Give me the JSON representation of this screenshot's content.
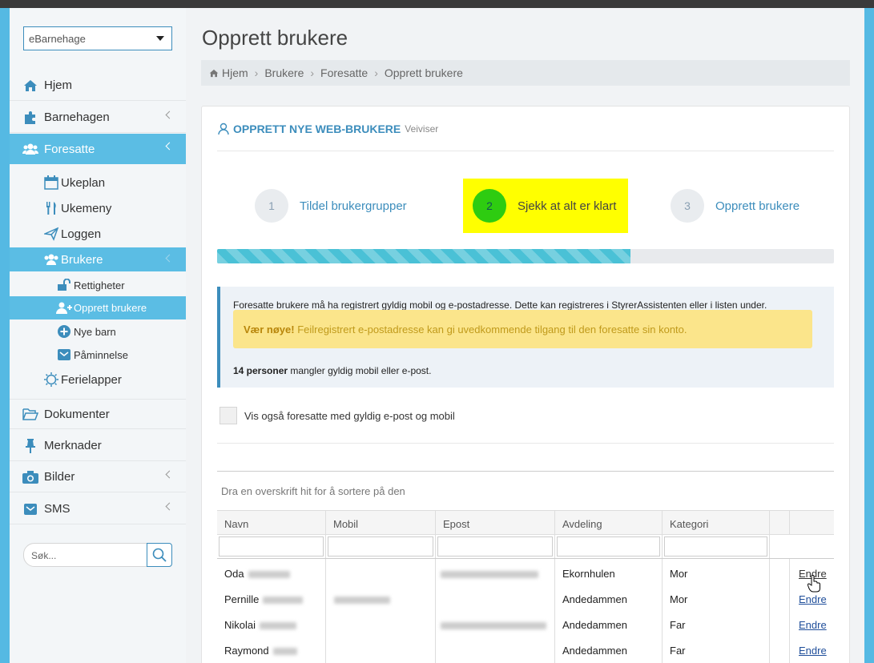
{
  "select": {
    "value": "eBarnehage"
  },
  "nav": [
    {
      "label": "Hjem"
    },
    {
      "label": "Barnehagen"
    },
    {
      "label": "Foresatte"
    },
    {
      "label": "Dokumenter"
    },
    {
      "label": "Merknader"
    },
    {
      "label": "Bilder"
    },
    {
      "label": "SMS"
    }
  ],
  "sub": [
    {
      "label": "Ukeplan"
    },
    {
      "label": "Ukemeny"
    },
    {
      "label": "Loggen"
    },
    {
      "label": "Brukere"
    },
    {
      "label": "Ferielapper"
    }
  ],
  "subsub": [
    {
      "label": "Rettigheter"
    },
    {
      "label": "Opprett brukere"
    },
    {
      "label": "Nye barn"
    },
    {
      "label": "Påminnelse"
    }
  ],
  "search": {
    "placeholder": "Søk..."
  },
  "page": {
    "title": "Opprett brukere"
  },
  "breadcrumb": [
    "Hjem",
    "Brukere",
    "Foresatte",
    "Opprett brukere"
  ],
  "panel": {
    "title": "OPPRETT NYE WEB-BRUKERE",
    "subtitle": "Veiviser"
  },
  "steps": [
    {
      "num": "1",
      "label": "Tildel brukergrupper"
    },
    {
      "num": "2",
      "label": "Sjekk at alt er klart"
    },
    {
      "num": "3",
      "label": "Opprett brukere"
    }
  ],
  "progress": {
    "value": 0.67
  },
  "info": {
    "line1": "Foresatte brukere må ha registrert gyldig mobil og e-postadresse. Dette kan registreres i StyrerAssistenten eller i listen under.",
    "warn_bold": "Vær nøye!",
    "warn_text": " Feilregistrert e-postadresse kan gi uvedkommende tilgang til den foresatte sin konto.",
    "count_bold": "14 personer",
    "count_text": " mangler gyldig mobil eller e-post."
  },
  "checkbox": {
    "label": "Vis også foresatte med gyldig e-post og mobil"
  },
  "grid": {
    "group_hint": "Dra en overskrift hit for å sortere på den",
    "columns": [
      "Navn",
      "Mobil",
      "Epost",
      "Avdeling",
      "Kategori"
    ],
    "rows": [
      {
        "navn": "Oda",
        "avdeling": "Ekornhulen",
        "kategori": "Mor",
        "action": "Endre"
      },
      {
        "navn": "Pernille",
        "avdeling": "Andedammen",
        "kategori": "Mor",
        "action": "Endre"
      },
      {
        "navn": "Nikolai",
        "avdeling": "Andedammen",
        "kategori": "Far",
        "action": "Endre"
      },
      {
        "navn": "Raymond",
        "avdeling": "Andedammen",
        "kategori": "Far",
        "action": "Endre"
      }
    ]
  },
  "colors": {
    "accent": "#3c8dbc",
    "sidebar_active": "#5bbde4",
    "highlight": "#ffff00",
    "step_current": "#2ecc11"
  }
}
